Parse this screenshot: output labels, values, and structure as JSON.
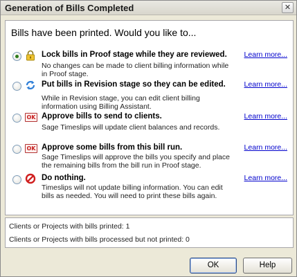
{
  "window": {
    "title": "Generation of Bills Completed",
    "close_glyph": "✕"
  },
  "heading": "Bills have been printed.  Would you like to...",
  "options": [
    {
      "title": "Lock bills in Proof stage while they are reviewed.",
      "desc": "No changes can be made to client billing information while in Proof stage.",
      "learn": "Learn more...",
      "icon": "lock-icon",
      "selected": true
    },
    {
      "title": "Put bills in Revision stage so they can be edited.",
      "desc": "While in Revision stage, you can edit client billing information using Billing Assistant.",
      "learn": "Learn more...",
      "icon": "revision-arrows-icon",
      "selected": false
    },
    {
      "title": "Approve bills to send to clients.",
      "desc": "Sage Timeslips will update client balances and records.",
      "learn": "Learn more...",
      "icon": "ok-icon",
      "icon_text": "OK",
      "selected": false
    },
    {
      "title": "Approve some bills from this bill run.",
      "desc": "Sage Timeslips will approve the bills you specify and place the remaining bills from the bill run in Proof stage.",
      "learn": "Learn more...",
      "icon": "ok-icon",
      "icon_text": "OK",
      "selected": false
    },
    {
      "title": "Do nothing.",
      "desc": "Timeslips will not update billing information. You can edit bills as needed. You will need to print these bills again.",
      "learn": "Learn more...",
      "icon": "prohibited-icon",
      "selected": false
    }
  ],
  "status": {
    "printed": "Clients or Projects with bills printed: 1",
    "not_printed": "Clients or Projects with bills processed but not printed: 0"
  },
  "buttons": {
    "ok": "OK",
    "help": "Help"
  },
  "colors": {
    "accent_radio": "#2d7b1a",
    "link": "#0000cc",
    "ok_red": "#c72121"
  }
}
